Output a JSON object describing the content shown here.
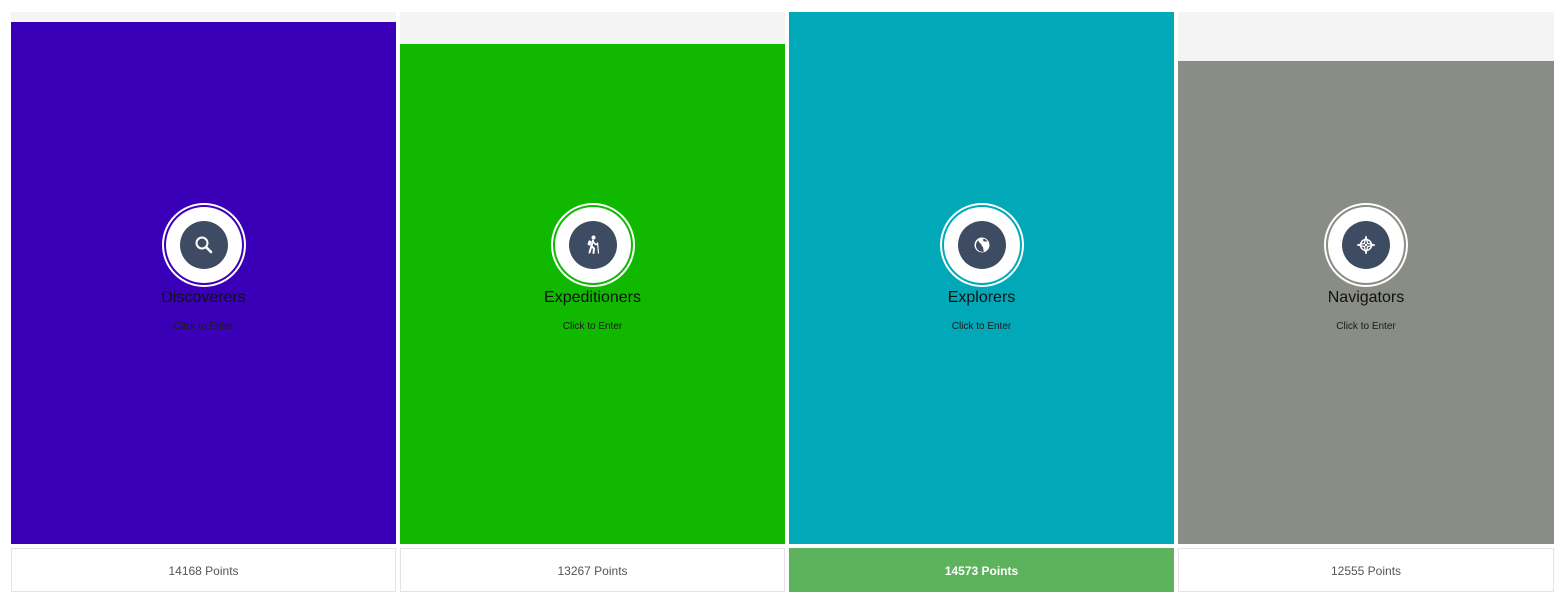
{
  "leaderboard": {
    "max_points": 14573,
    "teams": [
      {
        "name": "Discoverers",
        "hint": "Click to Enter",
        "points": 14168,
        "points_label": "14168 Points",
        "color": "#3a00b8",
        "icon": "magnifier-icon",
        "leader": false
      },
      {
        "name": "Expeditioners",
        "hint": "Click to Enter",
        "points": 13267,
        "points_label": "13267 Points",
        "color": "#10b800",
        "icon": "hiker-icon",
        "leader": false
      },
      {
        "name": "Explorers",
        "hint": "Click to Enter",
        "points": 14573,
        "points_label": "14573 Points",
        "color": "#00a8b8",
        "icon": "globe-icon",
        "leader": true
      },
      {
        "name": "Navigators",
        "hint": "Click to Enter",
        "points": 12555,
        "points_label": "12555 Points",
        "color": "#8a8d85",
        "icon": "compass-icon",
        "leader": false
      }
    ],
    "leader_points_color": "#5cb35c"
  }
}
